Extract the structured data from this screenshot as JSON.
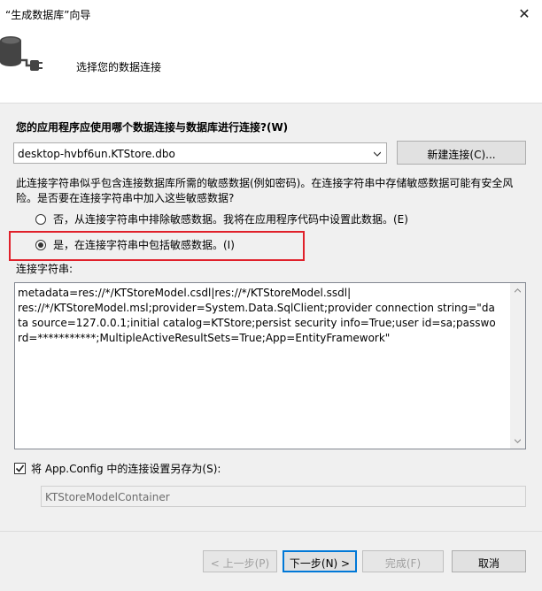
{
  "window": {
    "title": "“生成数据库”向导",
    "close_glyph": "✕"
  },
  "header": {
    "title": "选择您的数据连接",
    "icon": "database-plug-icon"
  },
  "question": "您的应用程序应使用哪个数据连接与数据库进行连接?(W)",
  "connection": {
    "selected": "desktop-hvbf6un.KTStore.dbo",
    "new_button": "新建连接(C)..."
  },
  "warning": "此连接字符串似乎包含连接数据库所需的敏感数据(例如密码)。在连接字符串中存储敏感数据可能有安全风险。是否要在连接字符串中加入这些敏感数据?",
  "options": [
    {
      "label": "否，从连接字符串中排除敏感数据。我将在应用程序代码中设置此数据。(E)",
      "checked": false
    },
    {
      "label": "是，在连接字符串中包括敏感数据。(I)",
      "checked": true
    }
  ],
  "connection_string": {
    "label": "连接字符串:",
    "value": "metadata=res://*/KTStoreModel.csdl|res://*/KTStoreModel.ssdl|\nres://*/KTStoreModel.msl;provider=System.Data.SqlClient;provider connection string=\"data source=127.0.0.1;initial catalog=KTStore;persist security info=True;user id=sa;password=***********;MultipleActiveResultSets=True;App=EntityFramework\""
  },
  "save_config": {
    "label": "将 App.Config 中的连接设置另存为(S):",
    "checked": true,
    "value": "KTStoreModelContainer"
  },
  "buttons": {
    "prev": "< 上一步(P)",
    "next": "下一步(N) >",
    "finish": "完成(F)",
    "cancel": "取消"
  },
  "colors": {
    "highlight": "#e0202a",
    "accent": "#0078d7"
  }
}
